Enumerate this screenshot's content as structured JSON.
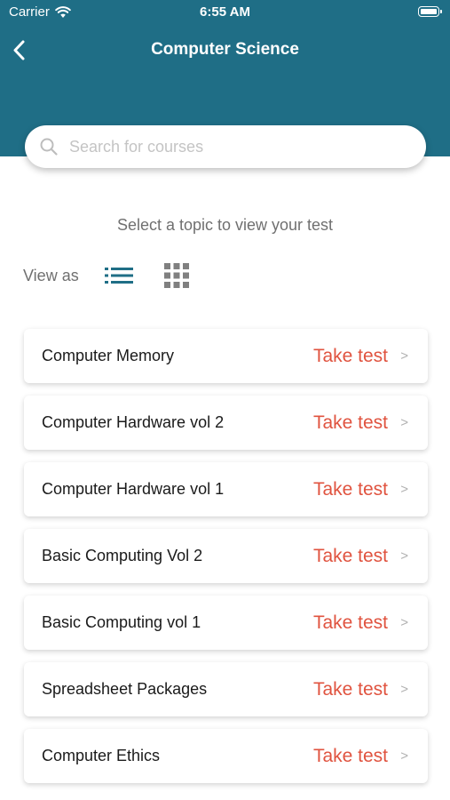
{
  "status_bar": {
    "carrier": "Carrier",
    "time": "6:55 AM"
  },
  "header": {
    "title": "Computer Science"
  },
  "search": {
    "placeholder": "Search for courses",
    "value": ""
  },
  "instruction": "Select a topic to view your test",
  "view_toggle": {
    "label": "View as",
    "selected": "list"
  },
  "colors": {
    "header_bg": "#1f6e86",
    "accent": "#e0533f",
    "selected_icon": "#1f6e86",
    "unselected_icon": "#808080"
  },
  "topics": [
    {
      "name": "Computer Memory",
      "action": "Take test",
      "chevron": ">"
    },
    {
      "name": "Computer Hardware vol 2",
      "action": "Take test",
      "chevron": ">"
    },
    {
      "name": "Computer Hardware vol 1",
      "action": "Take test",
      "chevron": ">"
    },
    {
      "name": "Basic Computing Vol 2",
      "action": "Take test",
      "chevron": ">"
    },
    {
      "name": "Basic Computing vol 1",
      "action": "Take test",
      "chevron": ">"
    },
    {
      "name": "Spreadsheet Packages",
      "action": "Take test",
      "chevron": ">"
    },
    {
      "name": "Computer Ethics",
      "action": "Take test",
      "chevron": ">"
    }
  ]
}
